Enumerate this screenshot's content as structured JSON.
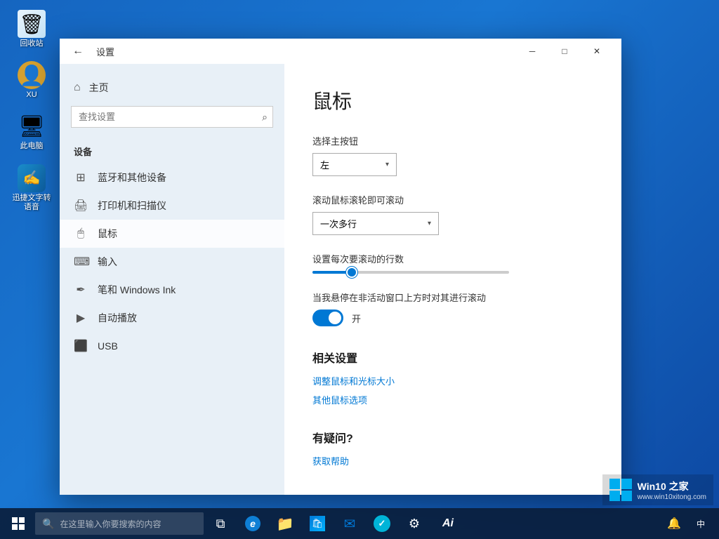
{
  "desktop": {
    "icons": [
      {
        "id": "recycle-bin",
        "label": "回收站",
        "symbol": "🗑"
      },
      {
        "id": "user-xu",
        "label": "XU",
        "symbol": "👤"
      },
      {
        "id": "this-pc",
        "label": "此电脑",
        "symbol": "💻"
      },
      {
        "id": "voice-app",
        "label": "迅捷文字转语音",
        "symbol": ""
      }
    ]
  },
  "settings_window": {
    "title": "设置",
    "back_label": "←",
    "min_label": "─",
    "max_label": "□",
    "close_label": "✕",
    "sidebar": {
      "home_label": "主页",
      "search_placeholder": "查找设置",
      "section_title": "设备",
      "items": [
        {
          "id": "bluetooth",
          "label": "蓝牙和其他设备",
          "icon": "⊞"
        },
        {
          "id": "printer",
          "label": "打印机和扫描仪",
          "icon": "🖨"
        },
        {
          "id": "mouse",
          "label": "鼠标",
          "icon": "🖱"
        },
        {
          "id": "input",
          "label": "输入",
          "icon": "⌨"
        },
        {
          "id": "pen",
          "label": "笔和 Windows Ink",
          "icon": "✏"
        },
        {
          "id": "autoplay",
          "label": "自动播放",
          "icon": "⟳"
        },
        {
          "id": "usb",
          "label": "USB",
          "icon": "⬛"
        }
      ]
    },
    "main": {
      "page_title": "鼠标",
      "primary_button_label": "选择主按钮",
      "primary_button_value": "左",
      "scroll_label": "滚动鼠标滚轮即可滚动",
      "scroll_value": "一次多行",
      "scroll_lines_label": "设置每次要滚动的行数",
      "inactive_scroll_label": "当我悬停在非活动窗口上方时对其进行滚动",
      "inactive_scroll_state": "开",
      "related_settings_title": "相关设置",
      "link1": "调整鼠标和光标大小",
      "link2": "其他鼠标选项",
      "faq_title": "有疑问?",
      "faq_link": "获取帮助"
    }
  },
  "taskbar": {
    "search_placeholder": "在这里输入你要搜索的内容",
    "win10_label": "Win10 之家",
    "win10_subtitle": "www.win10xitong.com",
    "ai_label": "Ai"
  }
}
